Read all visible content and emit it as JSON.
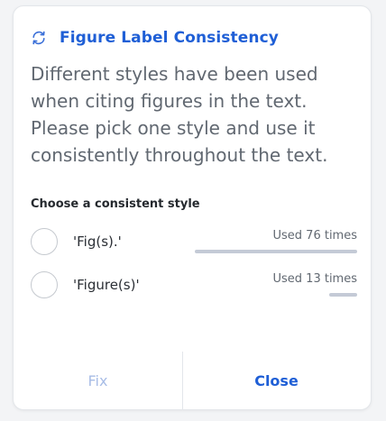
{
  "card": {
    "icon": "refresh-icon",
    "title": "Figure Label Consistency",
    "description": "Different styles have been used when citing figures in the text. Please pick one style and use it consistently throughout the text.",
    "section_label": "Choose a consistent style"
  },
  "options": [
    {
      "label": "'Fig(s).'",
      "usage": "Used 76 times",
      "count": 76,
      "selected": false
    },
    {
      "label": "'Figure(s)'",
      "usage": "Used 13 times",
      "count": 13,
      "selected": false
    }
  ],
  "footer": {
    "fix_label": "Fix",
    "close_label": "Close"
  },
  "colors": {
    "accent": "#1f5fd6",
    "accent_disabled": "#a8bde6",
    "usage_bar": "#c4cad6",
    "body_text": "#616871"
  }
}
